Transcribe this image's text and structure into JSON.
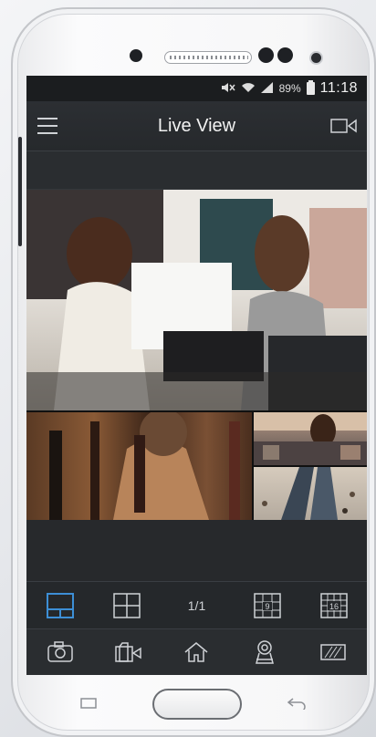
{
  "status_bar": {
    "battery_percent": "89%",
    "time": "11:18",
    "icons": [
      "mute-icon",
      "wifi-icon",
      "signal-icon",
      "battery-charging-icon"
    ]
  },
  "header": {
    "title": "Live View",
    "left_icon": "menu-icon",
    "right_icon": "video-record-icon"
  },
  "feeds": [
    {
      "name": "camera-feed-main",
      "scene": "retail-checkout"
    },
    {
      "name": "camera-feed-2",
      "scene": "wine-aisle"
    },
    {
      "name": "camera-feed-3",
      "scene": "store-interior"
    },
    {
      "name": "camera-feed-4",
      "scene": "escalator-mall"
    }
  ],
  "layout_bar": {
    "page_indicator": "1/1",
    "buttons": [
      "layout-custom-icon",
      "layout-4-icon",
      "layout-9-icon",
      "layout-16-icon"
    ],
    "layout_9_label": "9",
    "layout_16_label": "16",
    "active": "layout-custom-icon"
  },
  "toolbar": {
    "buttons": [
      "snapshot-camera-icon",
      "video-record-icon",
      "home-icon",
      "ptz-icon",
      "fullscreen-icon"
    ]
  },
  "colors": {
    "accent": "#3d8fd6",
    "icon": "#cfd2d6",
    "screen_bg": "#232629"
  }
}
